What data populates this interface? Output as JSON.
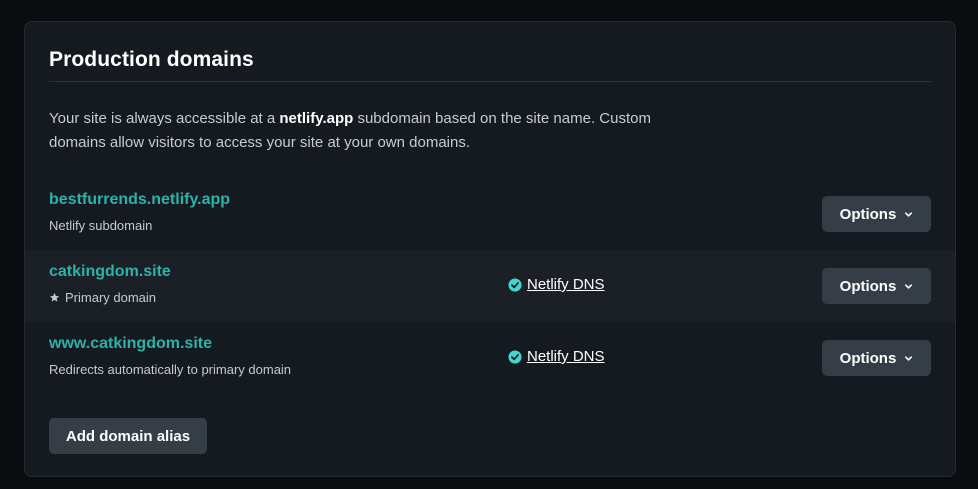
{
  "section": {
    "title": "Production domains",
    "description": {
      "before": "Your site is always accessible at a ",
      "emphasis": "netlify.app",
      "after": " subdomain based on the site name. Custom domains allow visitors to access your site at your own domains."
    }
  },
  "domains": [
    {
      "name": "bestfurrends.netlify.app",
      "subtitle": "Netlify subdomain",
      "primary": false,
      "dns": null,
      "options_label": "Options"
    },
    {
      "name": "catkingdom.site",
      "subtitle": "Primary domain",
      "primary": true,
      "dns": "Netlify DNS",
      "options_label": "Options"
    },
    {
      "name": "www.catkingdom.site",
      "subtitle": "Redirects automatically to primary domain",
      "primary": false,
      "dns": "Netlify DNS",
      "options_label": "Options"
    }
  ],
  "add_alias_label": "Add domain alias",
  "icons": {
    "star": "star-icon",
    "dns_status": "check-circle-icon",
    "options_caret": "chevron-down-icon"
  },
  "colors": {
    "background": "#0a0d10",
    "card": "#151a20",
    "accent_link": "#2ab3a8",
    "check": "#40d6d2",
    "button": "#353d46"
  }
}
